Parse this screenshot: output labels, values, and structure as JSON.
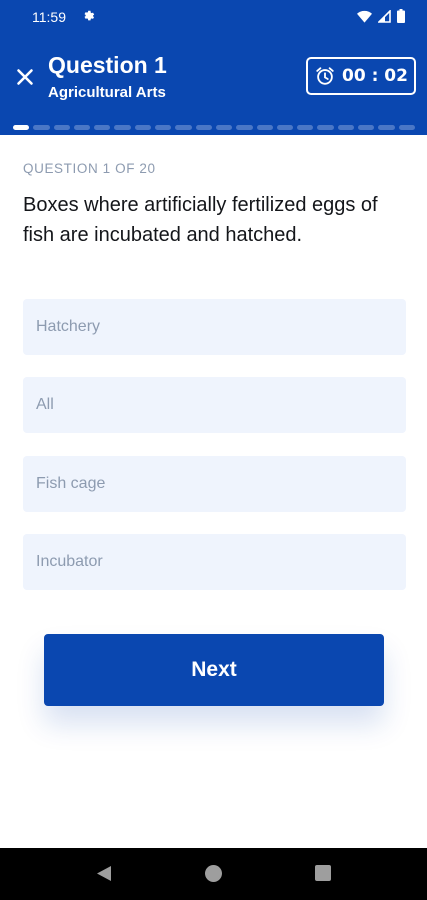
{
  "status_bar": {
    "time": "11:59",
    "icons": [
      "settings-gear-icon",
      "wifi-icon",
      "signal-icon",
      "battery-icon"
    ]
  },
  "header": {
    "title": "Question 1",
    "subtitle": "Agricultural Arts",
    "close_icon": "close-icon",
    "timer": {
      "icon": "alarm-clock-icon",
      "value": "00 : 02"
    },
    "progress": {
      "total_segments": 20,
      "current": 1
    }
  },
  "question": {
    "counter": "QUESTION 1 OF 20",
    "text": "Boxes where artificially fertilized eggs of fish are incubated and hatched."
  },
  "options": [
    {
      "label": "Hatchery"
    },
    {
      "label": "All"
    },
    {
      "label": "Fish cage"
    },
    {
      "label": "Incubator"
    }
  ],
  "actions": {
    "next_label": "Next"
  },
  "colors": {
    "brand": "#0a47b0",
    "option_bg": "#eff4fd",
    "muted_text": "#8d9bb0",
    "question_text": "#14161a"
  }
}
